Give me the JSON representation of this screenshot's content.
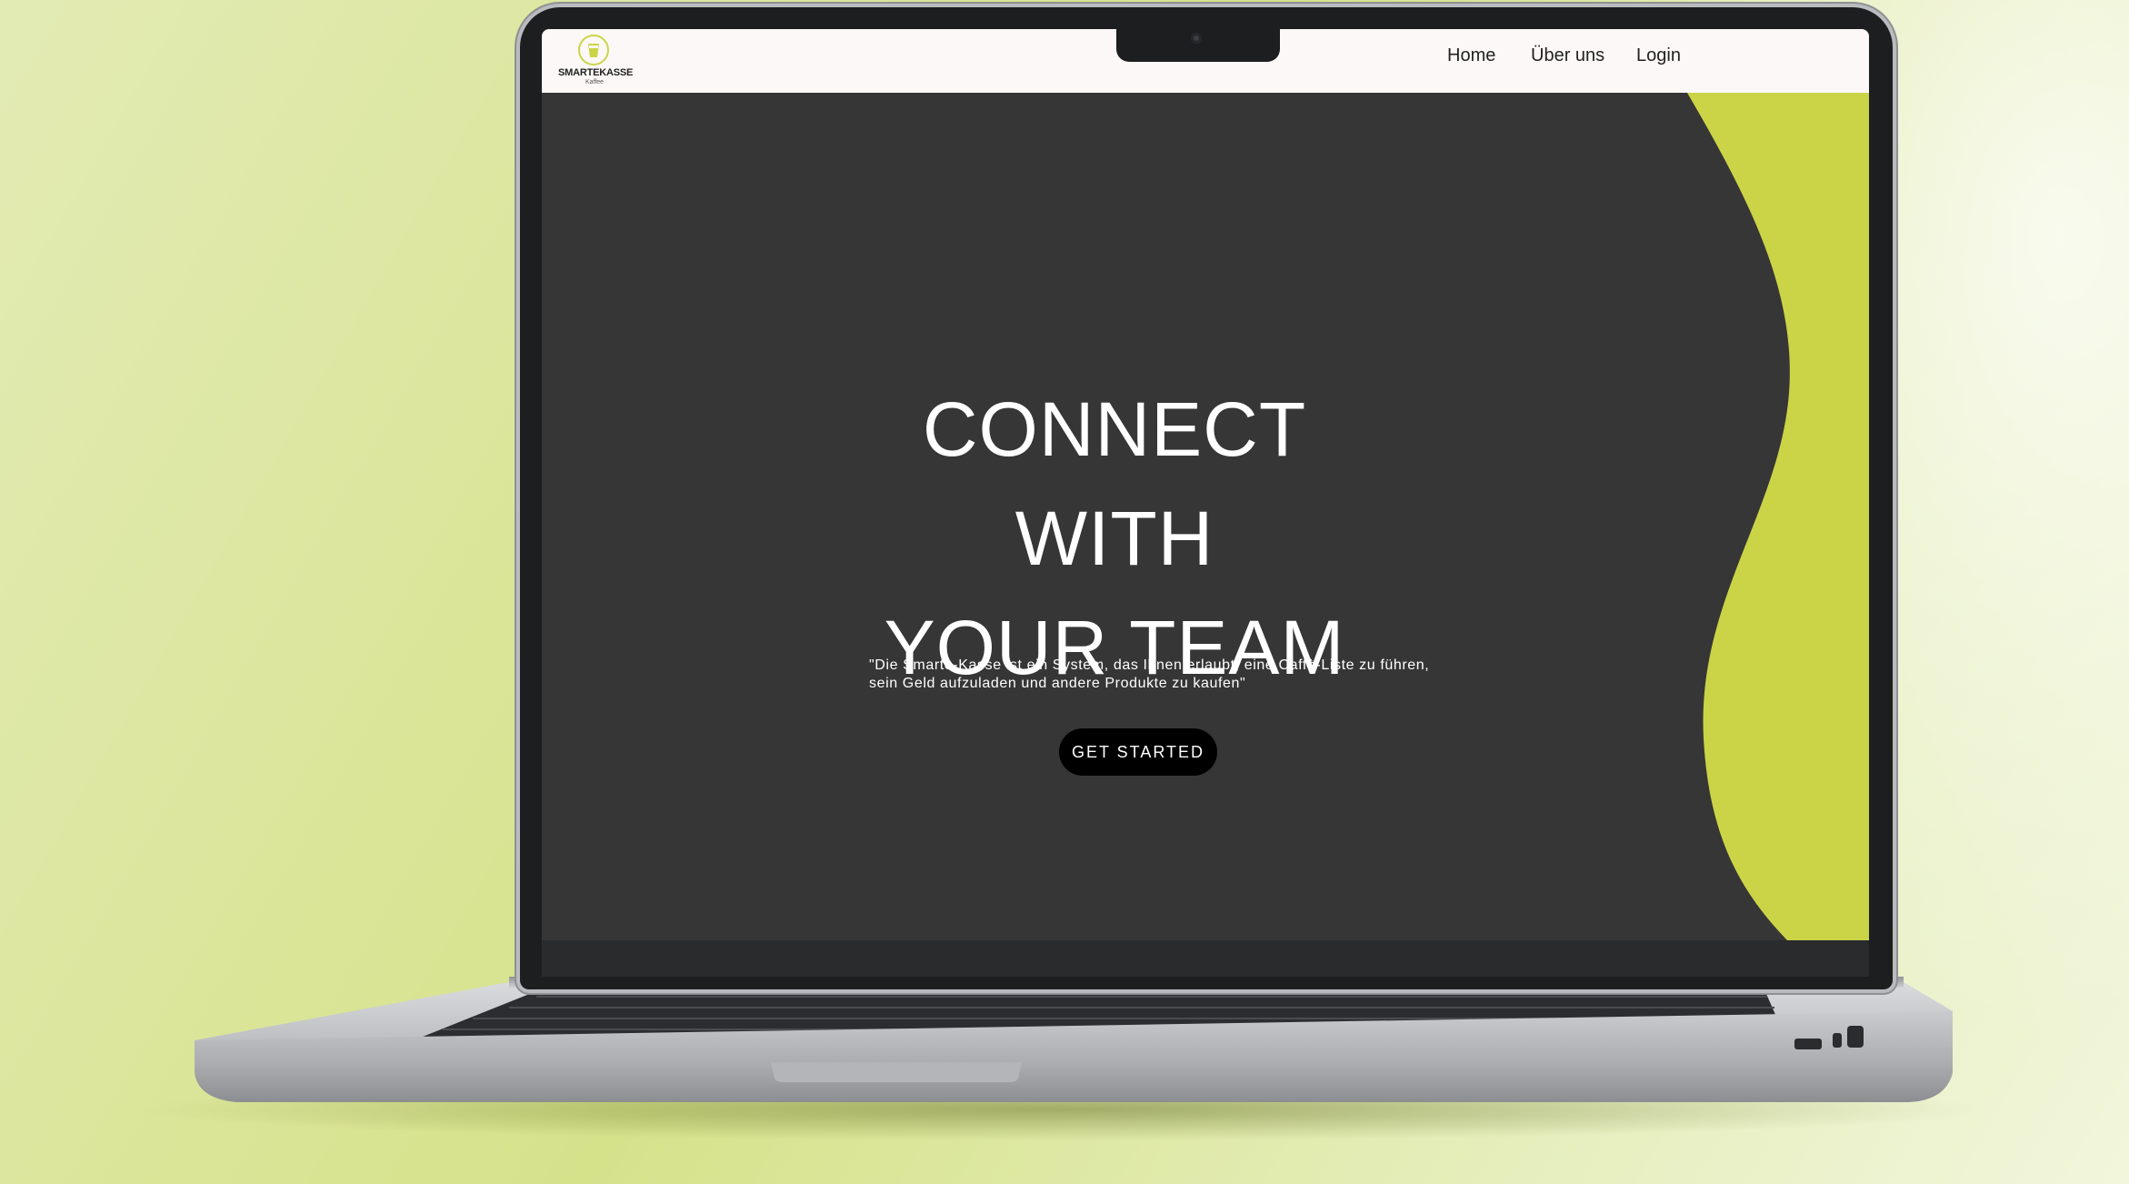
{
  "colors": {
    "background_accent": "#d6e28a",
    "hero_background": "#363636",
    "wave_accent": "#cbd446",
    "header_background": "#fcf8f7",
    "cta_background": "#000000"
  },
  "logo": {
    "title": "SMARTEKASSE",
    "subtitle": "Kaffee",
    "icon": "coffee-cup-icon"
  },
  "nav": {
    "items": [
      {
        "label": "Home"
      },
      {
        "label": "Über uns"
      },
      {
        "label": "Login"
      }
    ]
  },
  "hero": {
    "title_line1": "CONNECT WITH",
    "title_line2": "YOUR TEAM",
    "subtitle": "\"Die Smarte-Kasse ist ein System, das Ihnen erlaubt, eine Caffè-Liste zu führen, sein Geld aufzuladen und andere Produkte zu kaufen\"",
    "cta_label": "GET STARTED"
  }
}
